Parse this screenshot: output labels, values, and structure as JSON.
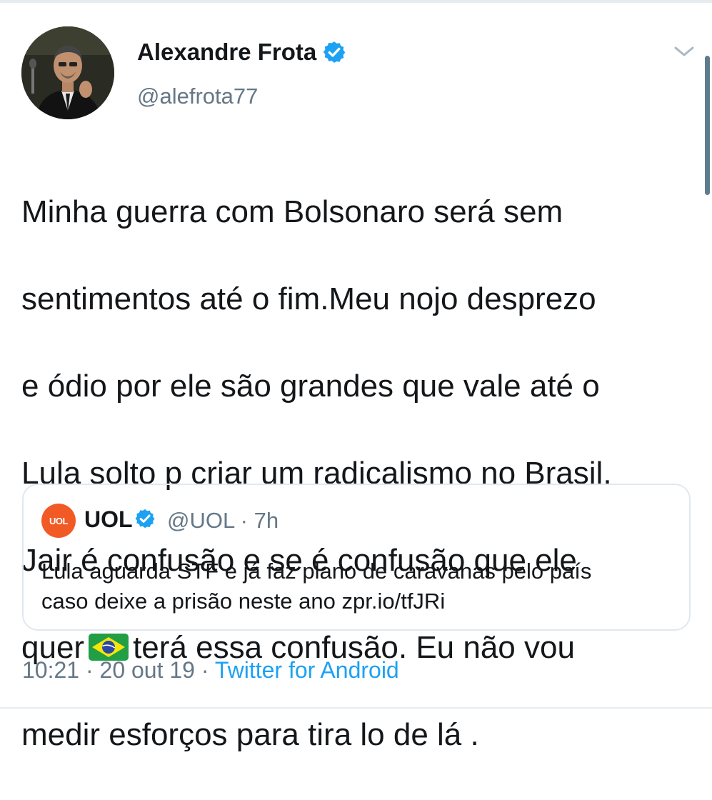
{
  "author": {
    "name": "Alexandre Frota",
    "handle": "@alefrota77",
    "verified": true,
    "avatar_icon": "profile-photo"
  },
  "tweet": {
    "lines": [
      "Minha guerra com Bolsonaro será sem",
      "sentimentos até o fim.Meu nojo desprezo",
      "e ódio por ele são  grandes que vale até o",
      "Lula solto p criar um radicalismo no Brasil.",
      "Jair é  confusão e se é confusão que ele"
    ],
    "line6_before_emoji": "quer",
    "line6_after_emoji": "terá essa confusão. Eu não vou",
    "line7": "medir esforços para tira lo de lá .",
    "emoji": "brazil-flag-icon"
  },
  "quoted": {
    "logo_text": "UOL",
    "name": "UOL",
    "verified": true,
    "handle": "@UOL",
    "time": "7h",
    "text": "Lula aguarda STF e já faz plano de caravanas pelo país\ncaso deixe a prisão neste ano zpr.io/tfJRi"
  },
  "footer": {
    "time": "10:21",
    "date": "20 out 19",
    "source": "Twitter for Android"
  },
  "colors": {
    "accent": "#1da1f2",
    "secondary_text": "#657786",
    "uol_brand": "#f15a24"
  }
}
